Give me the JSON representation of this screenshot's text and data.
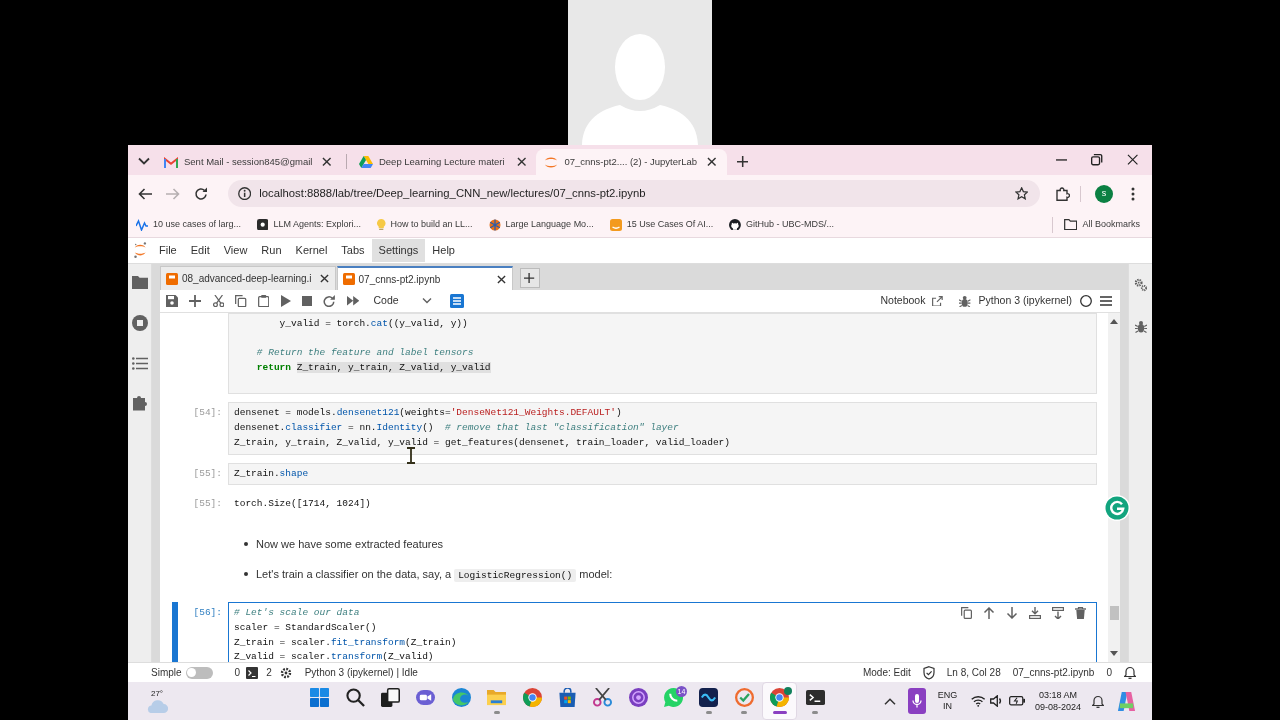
{
  "browser": {
    "tabs": [
      {
        "kind": "mail",
        "title": "Sent Mail - session845@gmail",
        "selected": false
      },
      {
        "kind": "drive",
        "title": "Deep Learning Lecture materi",
        "selected": false
      },
      {
        "kind": "jupyter",
        "title": "07_cnns-pt2.... (2) - JupyterLab",
        "selected": true
      }
    ],
    "forward_disabled": true,
    "address": "localhost:8888/lab/tree/Deep_learning_CNN_new/lectures/07_cnns-pt2.ipynb",
    "profile_initial": "s",
    "bookmarks": [
      {
        "kind": "wave",
        "title": "10 use cases of larg..."
      },
      {
        "kind": "square",
        "title": "LLM Agents: Explori..."
      },
      {
        "kind": "bulb",
        "title": "How to build an LL..."
      },
      {
        "kind": "flower",
        "title": "Large Language Mo..."
      },
      {
        "kind": "tile",
        "title": "15 Use Cases Of AI..."
      },
      {
        "kind": "cat",
        "title": "GitHub - UBC-MDS/..."
      }
    ],
    "all_bookmarks": "All Bookmarks"
  },
  "jupyterlab": {
    "menu": [
      {
        "label": "File",
        "selected": false
      },
      {
        "label": "Edit",
        "selected": false
      },
      {
        "label": "View",
        "selected": false
      },
      {
        "label": "Run",
        "selected": false
      },
      {
        "label": "Kernel",
        "selected": false
      },
      {
        "label": "Tabs",
        "selected": false
      },
      {
        "label": "Settings",
        "selected": true
      },
      {
        "label": "Help",
        "selected": false
      }
    ],
    "tabs": [
      {
        "title": "08_advanced-deep-learning.i",
        "selected": false
      },
      {
        "title": "07_cnns-pt2.ipynb",
        "selected": true
      }
    ],
    "toolbar": {
      "cell_type": "Code",
      "notebook": "Notebook",
      "kernel": "Python 3 (ipykernel)",
      "kernel_busy": false
    },
    "cells": [
      {
        "kind": "code",
        "active": false,
        "ends_with_blank_line": true,
        "blocks": [
          [
            [
              {
                "kind": "plain",
                "text": "        y_valid = torch."
              },
              {
                "kind": "prop",
                "text": "cat"
              },
              {
                "kind": "plain",
                "text": "((y_valid, y))"
              }
            ]
          ],
          [
            [
              {
                "kind": "comment",
                "text": "    # Return the feature and label tensors"
              }
            ],
            [
              {
                "kind": "kw",
                "text": "    return "
              },
              {
                "kind": "match",
                "text": "Z_train, y_train, Z_valid, y_valid"
              }
            ]
          ]
        ]
      },
      {
        "kind": "code",
        "active": false,
        "prompt": "[54]:",
        "blocks": [
          [
            [
              {
                "kind": "plain",
                "text": "densenet = models."
              },
              {
                "kind": "prop",
                "text": "densenet121"
              },
              {
                "kind": "plain",
                "text": "(weights="
              },
              {
                "kind": "string",
                "text": "'DenseNet121_Weights.DEFAULT'"
              },
              {
                "kind": "plain",
                "text": ")"
              }
            ],
            [
              {
                "kind": "plain",
                "text": "densenet."
              },
              {
                "kind": "prop",
                "text": "classifier"
              },
              {
                "kind": "plain",
                "text": " = nn."
              },
              {
                "kind": "prop",
                "text": "Identity"
              },
              {
                "kind": "plain",
                "text": "()  "
              },
              {
                "kind": "comment",
                "text": "# remove that last \"classification\" layer"
              }
            ],
            [
              {
                "kind": "plain",
                "text": "Z_train, y_train, Z_valid, y_valid = get_features(densenet, train_loader, valid_loader)"
              }
            ]
          ]
        ]
      },
      {
        "kind": "code",
        "active": false,
        "prompt": "[55]:",
        "blocks": [
          [
            [
              {
                "kind": "plain",
                "text": "Z_train."
              },
              {
                "kind": "prop",
                "text": "shape"
              }
            ]
          ]
        ],
        "output": {
          "prompt": "[55]:",
          "text": "torch.Size([1714, 1024])"
        }
      },
      {
        "kind": "markdown",
        "bullets": [
          [
            {
              "kind": "text",
              "text": "Now we have some extracted features"
            }
          ],
          [
            {
              "kind": "text",
              "text": "Let's train a classifier on the data, say, a "
            },
            {
              "kind": "code",
              "text": "LogisticRegression()"
            },
            {
              "kind": "text",
              "text": " model:"
            }
          ]
        ]
      },
      {
        "kind": "code",
        "active": true,
        "prompt": "[56]:",
        "blocks": [
          [
            [
              {
                "kind": "comment",
                "text": "# Let's scale our data"
              }
            ],
            [
              {
                "kind": "plain",
                "text": "scaler = StandardScaler()"
              }
            ],
            [
              {
                "kind": "plain",
                "text": "Z_train = scaler."
              },
              {
                "kind": "prop",
                "text": "fit_transform"
              },
              {
                "kind": "plain",
                "text": "(Z_train)"
              }
            ],
            [
              {
                "kind": "plain",
                "text": "Z_valid = scaler."
              },
              {
                "kind": "prop",
                "text": "transform"
              },
              {
                "kind": "plain",
                "text": "(Z_valid)"
              }
            ]
          ]
        ]
      }
    ],
    "status_bar": {
      "simple_label": "Simple",
      "simple_on": false,
      "terminals": "0",
      "kernels": "2",
      "kernel_status": "Python 3 (ipykernel) | Idle",
      "mode": "Mode: Edit",
      "position": "Ln 8, Col 28",
      "file": "07_cnns-pt2.ipynb",
      "notifications": "0"
    }
  },
  "taskbar": {
    "temperature": "27°",
    "apps": [
      {
        "kind": "start",
        "running": false,
        "selected": false
      },
      {
        "kind": "search",
        "running": false,
        "selected": false
      },
      {
        "kind": "taskview",
        "running": false,
        "selected": false
      },
      {
        "kind": "camera",
        "running": false,
        "selected": false
      },
      {
        "kind": "swirl",
        "running": false,
        "selected": false
      },
      {
        "kind": "folder",
        "running": true,
        "selected": false
      },
      {
        "kind": "chrome",
        "running": false,
        "selected": false
      },
      {
        "kind": "bag",
        "running": false,
        "selected": false
      },
      {
        "kind": "scissors",
        "running": false,
        "selected": false
      },
      {
        "kind": "rings",
        "running": false,
        "selected": false
      },
      {
        "kind": "bubble",
        "running": false,
        "selected": false,
        "badge": "14"
      },
      {
        "kind": "wave",
        "running": true,
        "selected": false
      },
      {
        "kind": "check",
        "running": true,
        "selected": false
      },
      {
        "kind": "chrome",
        "running": true,
        "selected": true,
        "badge_dot": true
      },
      {
        "kind": "terminal",
        "running": true,
        "selected": false
      }
    ],
    "language": "ENG",
    "region": "IN",
    "time": "03:18 AM",
    "date": "09-08-2024"
  }
}
